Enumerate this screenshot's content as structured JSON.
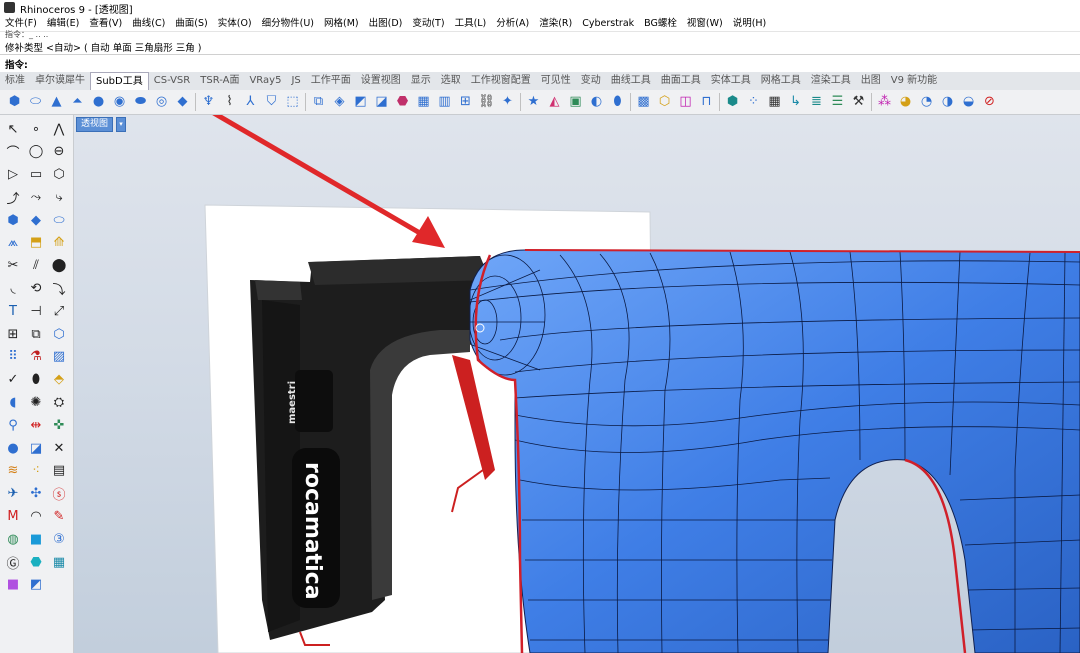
{
  "window": {
    "title": "Rhinoceros 9 - [透视图]"
  },
  "menu": [
    "文件(F)",
    "编辑(E)",
    "查看(V)",
    "曲线(C)",
    "曲面(S)",
    "实体(O)",
    "细分物件(U)",
    "网格(M)",
    "出图(D)",
    "变动(T)",
    "工具(L)",
    "分析(A)",
    "渲染(R)",
    "Cyberstrak",
    "BG螺栓",
    "视窗(W)",
    "说明(H)"
  ],
  "command": {
    "history_line": "指令：_ .. ..",
    "prompt_options": "修补类型 <自动> ( 自动  单面  三角扇形  三角 )",
    "label": "指令:"
  },
  "tabs": [
    {
      "label": "标准",
      "active": false
    },
    {
      "label": "卓尔谟犀牛",
      "active": false
    },
    {
      "label": "SubD工具",
      "active": true
    },
    {
      "label": "CS-VSR",
      "active": false
    },
    {
      "label": "TSR-A面",
      "active": false
    },
    {
      "label": "VRay5",
      "active": false
    },
    {
      "label": "JS",
      "active": false
    },
    {
      "label": "工作平面",
      "active": false
    },
    {
      "label": "设置视图",
      "active": false
    },
    {
      "label": "显示",
      "active": false
    },
    {
      "label": "选取",
      "active": false
    },
    {
      "label": "工作视窗配置",
      "active": false
    },
    {
      "label": "可见性",
      "active": false
    },
    {
      "label": "变动",
      "active": false
    },
    {
      "label": "曲线工具",
      "active": false
    },
    {
      "label": "曲面工具",
      "active": false
    },
    {
      "label": "实体工具",
      "active": false
    },
    {
      "label": "网格工具",
      "active": false
    },
    {
      "label": "渲染工具",
      "active": false
    },
    {
      "label": "出图",
      "active": false
    },
    {
      "label": "V9 新功能",
      "active": false
    }
  ],
  "toolbar_icons": [
    {
      "name": "subd-box-icon",
      "glyph": "⬢",
      "color": "#2f6fd0"
    },
    {
      "name": "subd-cylinder-icon",
      "glyph": "⬭",
      "color": "#2f6fd0"
    },
    {
      "name": "subd-cone-icon",
      "glyph": "▲",
      "color": "#2f6fd0"
    },
    {
      "name": "subd-truncated-cone-icon",
      "glyph": "⏶",
      "color": "#2f6fd0"
    },
    {
      "name": "subd-ball-icon",
      "glyph": "●",
      "color": "#2f6fd0"
    },
    {
      "name": "subd-sphere-icon",
      "glyph": "◉",
      "color": "#2f6fd0"
    },
    {
      "name": "subd-ellipsoid-icon",
      "glyph": "⬬",
      "color": "#2f6fd0"
    },
    {
      "name": "subd-torus-icon",
      "glyph": "◎",
      "color": "#2f6fd0"
    },
    {
      "name": "subd-plane-icon",
      "glyph": "◆",
      "color": "#2f6fd0"
    },
    {
      "name": "subd-tube-icon",
      "glyph": "♆",
      "color": "#2f6fd0"
    },
    {
      "name": "subd-curve-icon",
      "glyph": "⌇",
      "color": "#333"
    },
    {
      "name": "subd-branch-icon",
      "glyph": "⅄",
      "color": "#2f6fd0"
    },
    {
      "name": "subd-patch-icon",
      "glyph": "⛉",
      "color": "#2f6fd0"
    },
    {
      "name": "subd-extrude-icon",
      "glyph": "⬚",
      "color": "#2f6fd0"
    },
    {
      "name": "subd-bridge-icon",
      "glyph": "⧉",
      "color": "#2f6fd0"
    },
    {
      "name": "subd-slide-icon",
      "glyph": "◈",
      "color": "#2f6fd0"
    },
    {
      "name": "subd-crease-icon",
      "glyph": "◩",
      "color": "#2f6fd0"
    },
    {
      "name": "subd-fill-icon",
      "glyph": "◪",
      "color": "#2f6fd0"
    },
    {
      "name": "subd-weld-icon",
      "glyph": "⬣",
      "color": "#c0306a"
    },
    {
      "name": "subd-grid-icon",
      "glyph": "▦",
      "color": "#2f6fd0"
    },
    {
      "name": "subd-stripe-icon",
      "glyph": "▥",
      "color": "#2f6fd0"
    },
    {
      "name": "subd-mesh-icon",
      "glyph": "⊞",
      "color": "#2f6fd0"
    },
    {
      "name": "subd-bones-icon",
      "glyph": "⛓",
      "color": "#333"
    },
    {
      "name": "subd-link-icon",
      "glyph": "✦",
      "color": "#2f6fd0"
    },
    {
      "name": "subd-star-icon",
      "glyph": "★",
      "color": "#2f6fd0"
    },
    {
      "name": "subd-reflect-icon",
      "glyph": "◭",
      "color": "#d03070"
    },
    {
      "name": "subd-frame-icon",
      "glyph": "▣",
      "color": "#2e8b57"
    },
    {
      "name": "subd-dot-icon",
      "glyph": "◐",
      "color": "#2f6fd0"
    },
    {
      "name": "subd-drop-icon",
      "glyph": "⬮",
      "color": "#2f6fd0"
    },
    {
      "name": "subd-cube-grid-icon",
      "glyph": "▩",
      "color": "#2f6fd0"
    },
    {
      "name": "subd-gold-cube-icon",
      "glyph": "⬡",
      "color": "#d4a017"
    },
    {
      "name": "subd-magenta-cube-icon",
      "glyph": "◫",
      "color": "#c020b0"
    },
    {
      "name": "subd-stand-icon",
      "glyph": "⊓",
      "color": "#2f6fd0"
    },
    {
      "name": "subd-teal-box-icon",
      "glyph": "⬢",
      "color": "#1a8a8a"
    },
    {
      "name": "subd-dotted-icon",
      "glyph": "⁘",
      "color": "#2f6fd0"
    },
    {
      "name": "subd-checker-icon",
      "glyph": "▦",
      "color": "#333"
    },
    {
      "name": "subd-hook-icon",
      "glyph": "↳",
      "color": "#1a8aa8"
    },
    {
      "name": "subd-bars-icon",
      "glyph": "≣",
      "color": "#1a8a8a"
    },
    {
      "name": "subd-list-icon",
      "glyph": "☰",
      "color": "#2e8b57"
    },
    {
      "name": "subd-tools-icon",
      "glyph": "⚒",
      "color": "#333"
    },
    {
      "name": "subd-cluster-icon",
      "glyph": "⁂",
      "color": "#c020b0"
    },
    {
      "name": "subd-sphere-gold-icon",
      "glyph": "◕",
      "color": "#d4a017"
    },
    {
      "name": "subd-sphere-arrow-icon",
      "glyph": "◔",
      "color": "#2f6fd0"
    },
    {
      "name": "subd-sphere-blue-icon",
      "glyph": "◑",
      "color": "#2f6fd0"
    },
    {
      "name": "subd-sphere-check-icon",
      "glyph": "◒",
      "color": "#2f6fd0"
    },
    {
      "name": "subd-no-icon",
      "glyph": "⊘",
      "color": "#d02020"
    }
  ],
  "sidebar_icons": [
    {
      "name": "select-arrow-icon",
      "glyph": "↖",
      "color": "#222"
    },
    {
      "name": "point-icon",
      "glyph": "∘",
      "color": "#222"
    },
    {
      "name": "polyline-icon",
      "glyph": "⋀",
      "color": "#222"
    },
    {
      "name": "curve-cv-icon",
      "glyph": "⌒",
      "color": "#222"
    },
    {
      "name": "circle-icon",
      "glyph": "◯",
      "color": "#222"
    },
    {
      "name": "ellipse-icon",
      "glyph": "⊖",
      "color": "#222"
    },
    {
      "name": "polygon-icon",
      "glyph": "▷",
      "color": "#222"
    },
    {
      "name": "rectangle-icon",
      "glyph": "▭",
      "color": "#222"
    },
    {
      "name": "hexagon-icon",
      "glyph": "⬡",
      "color": "#222"
    },
    {
      "name": "fillet-curve-icon",
      "glyph": "⤴",
      "color": "#222"
    },
    {
      "name": "offset-curve-icon",
      "glyph": "⤳",
      "color": "#222"
    },
    {
      "name": "blend-curve-icon",
      "glyph": "⤷",
      "color": "#222"
    },
    {
      "name": "box-icon",
      "glyph": "⬢",
      "color": "#2f6fd0"
    },
    {
      "name": "surface-icon",
      "glyph": "◆",
      "color": "#2f6fd0"
    },
    {
      "name": "cylinder-icon",
      "glyph": "⬭",
      "color": "#2f6fd0"
    },
    {
      "name": "loft-icon",
      "glyph": "⩕",
      "color": "#2f6fd0"
    },
    {
      "name": "extrude-icon",
      "glyph": "⬒",
      "color": "#d4a017"
    },
    {
      "name": "sweep-icon",
      "glyph": "⟰",
      "color": "#d4a017"
    },
    {
      "name": "trim-icon",
      "glyph": "✂",
      "color": "#222"
    },
    {
      "name": "split-icon",
      "glyph": "⫽",
      "color": "#222"
    },
    {
      "name": "join-icon",
      "glyph": "⬤",
      "color": "#222"
    },
    {
      "name": "fillet-edge-icon",
      "glyph": "◟",
      "color": "#222"
    },
    {
      "name": "rebuild-icon",
      "glyph": "⟲",
      "color": "#222"
    },
    {
      "name": "match-icon",
      "glyph": "⤵",
      "color": "#222"
    },
    {
      "name": "text-icon",
      "glyph": "T",
      "color": "#1a5fb0"
    },
    {
      "name": "dimension-icon",
      "glyph": "⊣",
      "color": "#222"
    },
    {
      "name": "annotation-icon",
      "glyph": "⤢",
      "color": "#222"
    },
    {
      "name": "array-icon",
      "glyph": "⊞",
      "color": "#222"
    },
    {
      "name": "group-icon",
      "glyph": "⧉",
      "color": "#222"
    },
    {
      "name": "block-icon",
      "glyph": "⬡",
      "color": "#2f6fd0"
    },
    {
      "name": "points-grid-icon",
      "glyph": "⠿",
      "color": "#2f6fd0"
    },
    {
      "name": "bolt-icon",
      "glyph": "⚗",
      "color": "#c02020"
    },
    {
      "name": "hatch-icon",
      "glyph": "▨",
      "color": "#2f6fd0"
    },
    {
      "name": "check-icon",
      "glyph": "✓",
      "color": "#222"
    },
    {
      "name": "gumball-icon",
      "glyph": "⬮",
      "color": "#222"
    },
    {
      "name": "paint-icon",
      "glyph": "⬘",
      "color": "#d4a017"
    },
    {
      "name": "analyze-icon",
      "glyph": "◖",
      "color": "#2f6fd0"
    },
    {
      "name": "light-icon",
      "glyph": "✺",
      "color": "#222"
    },
    {
      "name": "render-icon",
      "glyph": "⛭",
      "color": "#222"
    },
    {
      "name": "pin-icon",
      "glyph": "⚲",
      "color": "#2f6fd0"
    },
    {
      "name": "mirror-icon",
      "glyph": "⇹",
      "color": "#d02020"
    },
    {
      "name": "cplane-icon",
      "glyph": "✜",
      "color": "#2e8b57"
    },
    {
      "name": "sphere-icon",
      "glyph": "●",
      "color": "#2f6fd0"
    },
    {
      "name": "flatten-icon",
      "glyph": "◪",
      "color": "#2f6fd0"
    },
    {
      "name": "explode-icon",
      "glyph": "✕",
      "color": "#222"
    },
    {
      "name": "zebra-icon",
      "glyph": "≋",
      "color": "#d48017"
    },
    {
      "name": "mesh-points-icon",
      "glyph": "⁖",
      "color": "#d4a017"
    },
    {
      "name": "save-icon",
      "glyph": "▤",
      "color": "#222"
    },
    {
      "name": "move-icon",
      "glyph": "✈",
      "color": "#1a5fb0"
    },
    {
      "name": "transform-icon",
      "glyph": "✣",
      "color": "#2f6fd0"
    },
    {
      "name": "s-icon",
      "glyph": "ⓢ",
      "color": "#d02020"
    },
    {
      "name": "m-icon",
      "glyph": "M",
      "color": "#d02020"
    },
    {
      "name": "curvature-icon",
      "glyph": "◠",
      "color": "#222"
    },
    {
      "name": "pen-icon",
      "glyph": "✎",
      "color": "#d02020"
    },
    {
      "name": "globe-icon",
      "glyph": "◍",
      "color": "#2e8b57"
    },
    {
      "name": "cube-blue-icon",
      "glyph": "■",
      "color": "#1a9ad8"
    },
    {
      "name": "three-icon",
      "glyph": "③",
      "color": "#2f6fd0"
    },
    {
      "name": "g-icon",
      "glyph": "Ⓖ",
      "color": "#222"
    },
    {
      "name": "teal-ball-icon",
      "glyph": "⬣",
      "color": "#1ab0c0"
    },
    {
      "name": "grid-teal-icon",
      "glyph": "▦",
      "color": "#1a8aa8"
    },
    {
      "name": "purple-cube-icon",
      "glyph": "■",
      "color": "#b050e0"
    },
    {
      "name": "layout-icon",
      "glyph": "◩",
      "color": "#2f6fd0"
    }
  ],
  "viewport": {
    "name": "透视图",
    "mesh_color": "#3f7ee6",
    "crease_color": "#d0202a"
  },
  "tool_object": {
    "brand": "rocamatica",
    "logo_text": "maestri"
  }
}
